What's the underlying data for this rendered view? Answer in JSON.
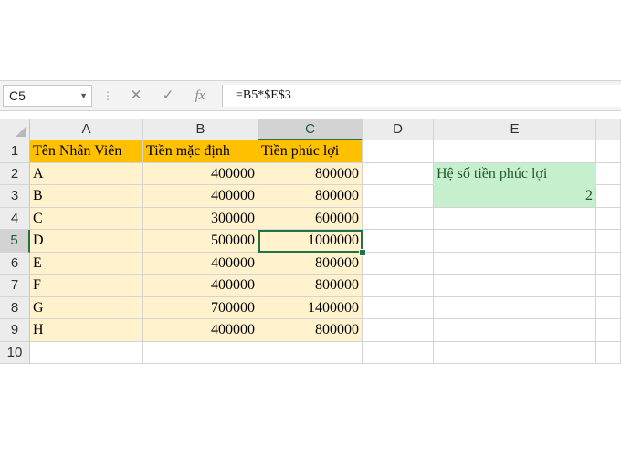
{
  "formula_bar": {
    "name_box": "C5",
    "dots": "⋮",
    "cancel": "✕",
    "enter": "✓",
    "fx": "fx",
    "formula": "=B5*$E$3"
  },
  "grid": {
    "columns": [
      "A",
      "B",
      "C",
      "D",
      "E"
    ],
    "rows": [
      "1",
      "2",
      "3",
      "4",
      "5",
      "6",
      "7",
      "8",
      "9",
      "10"
    ],
    "header": [
      "Tên Nhân Viên",
      "Tiền mặc định",
      "Tiền phúc lợi"
    ],
    "records": [
      [
        "A",
        "400000",
        "800000"
      ],
      [
        "B",
        "400000",
        "800000"
      ],
      [
        "C",
        "300000",
        "600000"
      ],
      [
        "D",
        "500000",
        "1000000"
      ],
      [
        "E",
        "400000",
        "800000"
      ],
      [
        "F",
        "400000",
        "800000"
      ],
      [
        "G",
        "700000",
        "1400000"
      ],
      [
        "H",
        "400000",
        "800000"
      ]
    ],
    "coefficient_label": "Hệ số tiền phúc lợi",
    "coefficient_value": "2",
    "active_cell": "C5"
  },
  "colors": {
    "header_fill": "#ffc000",
    "data_fill": "#fff2cc",
    "coefficient_fill": "#c6efce",
    "selection": "#217346"
  }
}
